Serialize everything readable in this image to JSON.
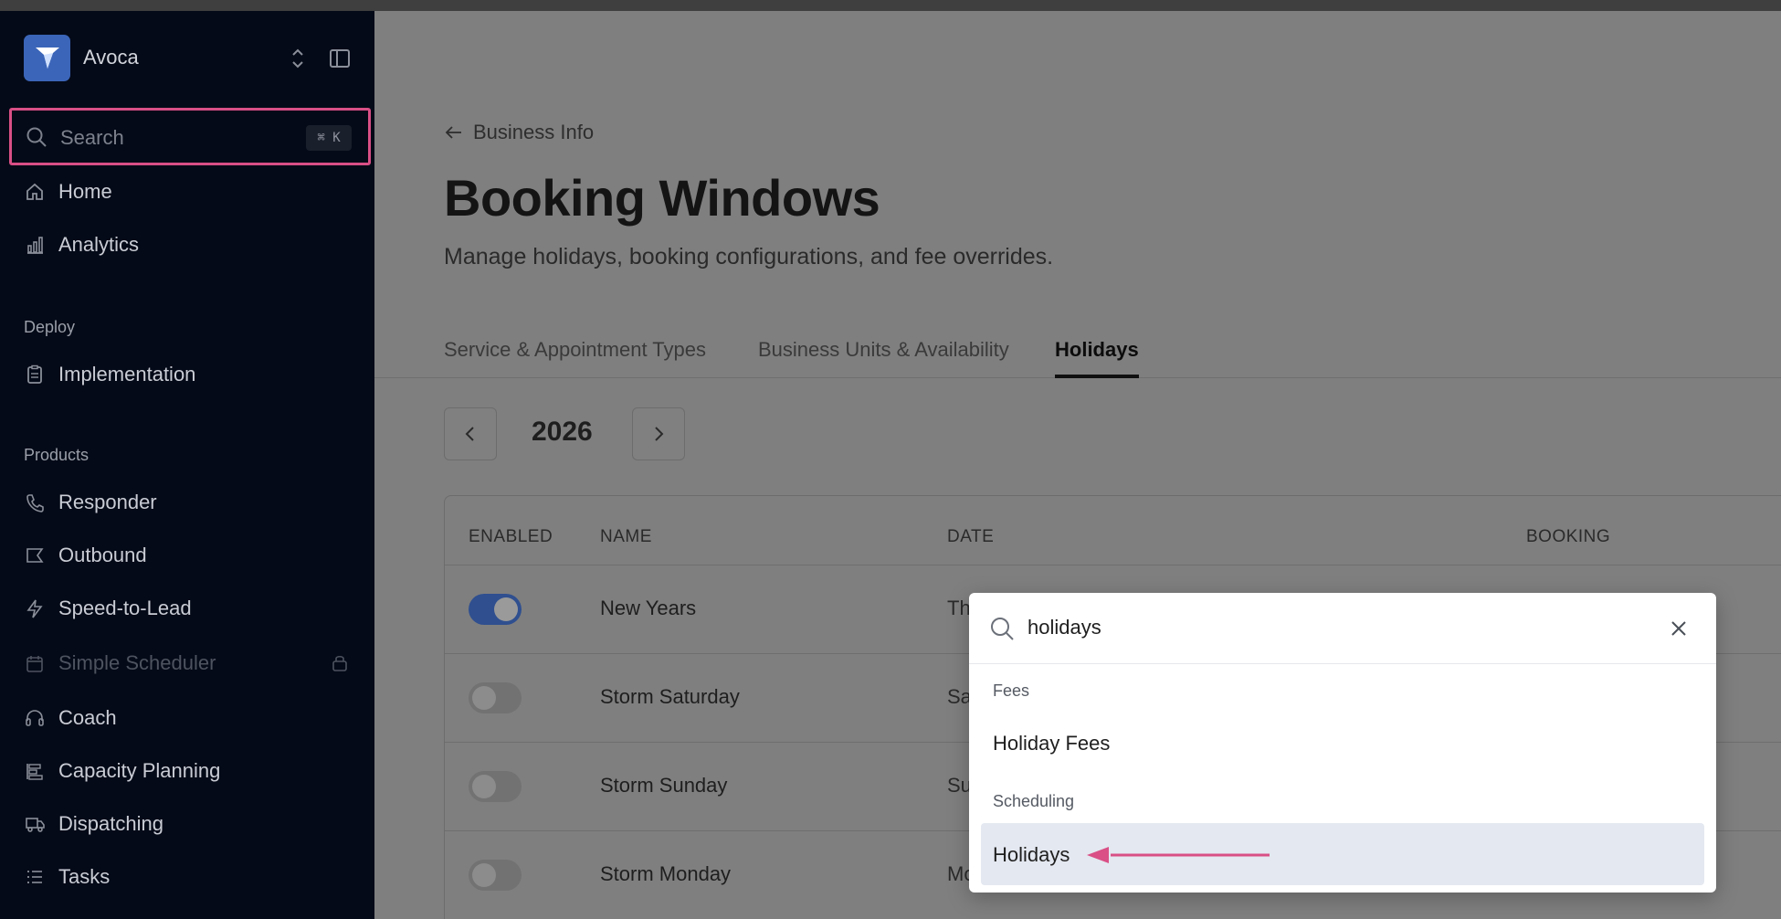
{
  "sidebar": {
    "brand": "Avoca",
    "search": {
      "label": "Search",
      "shortcut": "⌘ K"
    },
    "items_top": [
      {
        "label": "Home",
        "icon": "home-icon"
      },
      {
        "label": "Analytics",
        "icon": "bar-chart-icon"
      }
    ],
    "deploy": {
      "label": "Deploy",
      "items": [
        {
          "label": "Implementation",
          "icon": "clipboard-icon"
        }
      ]
    },
    "products": {
      "label": "Products",
      "items": [
        {
          "label": "Responder",
          "icon": "phone-icon"
        },
        {
          "label": "Outbound",
          "icon": "outbound-icon"
        },
        {
          "label": "Speed-to-Lead",
          "icon": "bolt-icon"
        },
        {
          "label": "Simple Scheduler",
          "icon": "calendar-icon",
          "disabled": true
        },
        {
          "label": "Coach",
          "icon": "headset-icon"
        },
        {
          "label": "Capacity Planning",
          "icon": "capacity-icon"
        },
        {
          "label": "Dispatching",
          "icon": "truck-icon"
        },
        {
          "label": "Tasks",
          "icon": "list-icon"
        }
      ]
    }
  },
  "main": {
    "back_label": "Business Info",
    "title": "Booking Windows",
    "subtitle": "Manage holidays, booking configurations, and fee overrides.",
    "tabs": [
      {
        "label": "Service & Appointment Types",
        "active": false
      },
      {
        "label": "Business Units & Availability",
        "active": false
      },
      {
        "label": "Holidays",
        "active": true
      }
    ],
    "year": "2026",
    "table": {
      "headers": [
        "ENABLED",
        "NAME",
        "DATE",
        "BOOKING"
      ],
      "rows": [
        {
          "enabled": true,
          "name": "New Years",
          "date": "Th"
        },
        {
          "enabled": false,
          "name": "Storm Saturday",
          "date": "Sa"
        },
        {
          "enabled": false,
          "name": "Storm Sunday",
          "date": "Su"
        },
        {
          "enabled": false,
          "name": "Storm Monday",
          "date": "Mo"
        }
      ]
    }
  },
  "palette": {
    "query": "holidays",
    "groups": [
      {
        "label": "Fees",
        "items": [
          {
            "label": "Holiday Fees",
            "selected": false
          }
        ]
      },
      {
        "label": "Scheduling",
        "items": [
          {
            "label": "Holidays",
            "selected": true
          }
        ]
      }
    ]
  },
  "colors": {
    "sidebar_bg": "#050a18",
    "accent_highlight": "#d94f86",
    "brand_blue": "#3b65b8",
    "toggle_on": "#2f4f8f"
  }
}
